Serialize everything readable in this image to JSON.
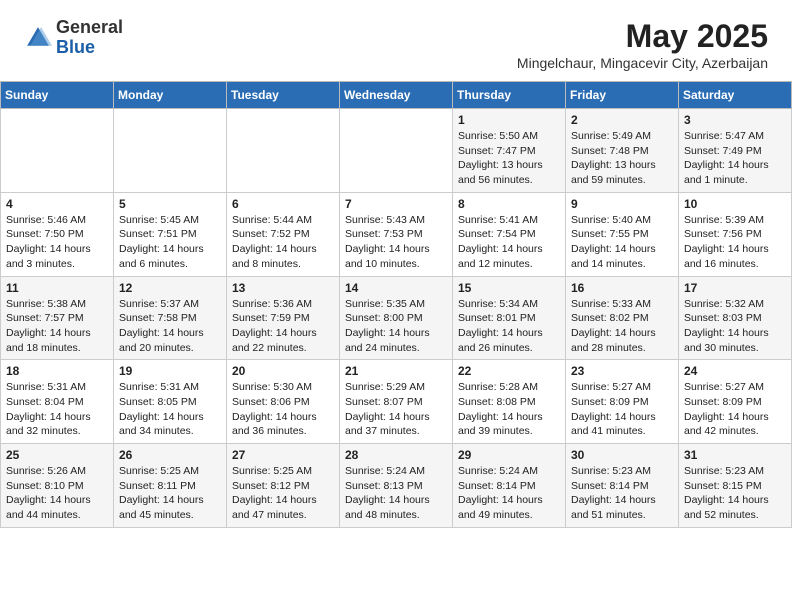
{
  "header": {
    "logo_general": "General",
    "logo_blue": "Blue",
    "month_year": "May 2025",
    "location": "Mingelchaur, Mingacevir City, Azerbaijan"
  },
  "weekdays": [
    "Sunday",
    "Monday",
    "Tuesday",
    "Wednesday",
    "Thursday",
    "Friday",
    "Saturday"
  ],
  "weeks": [
    [
      {
        "day": "",
        "info": ""
      },
      {
        "day": "",
        "info": ""
      },
      {
        "day": "",
        "info": ""
      },
      {
        "day": "",
        "info": ""
      },
      {
        "day": "1",
        "info": "Sunrise: 5:50 AM\nSunset: 7:47 PM\nDaylight: 13 hours\nand 56 minutes."
      },
      {
        "day": "2",
        "info": "Sunrise: 5:49 AM\nSunset: 7:48 PM\nDaylight: 13 hours\nand 59 minutes."
      },
      {
        "day": "3",
        "info": "Sunrise: 5:47 AM\nSunset: 7:49 PM\nDaylight: 14 hours\nand 1 minute."
      }
    ],
    [
      {
        "day": "4",
        "info": "Sunrise: 5:46 AM\nSunset: 7:50 PM\nDaylight: 14 hours\nand 3 minutes."
      },
      {
        "day": "5",
        "info": "Sunrise: 5:45 AM\nSunset: 7:51 PM\nDaylight: 14 hours\nand 6 minutes."
      },
      {
        "day": "6",
        "info": "Sunrise: 5:44 AM\nSunset: 7:52 PM\nDaylight: 14 hours\nand 8 minutes."
      },
      {
        "day": "7",
        "info": "Sunrise: 5:43 AM\nSunset: 7:53 PM\nDaylight: 14 hours\nand 10 minutes."
      },
      {
        "day": "8",
        "info": "Sunrise: 5:41 AM\nSunset: 7:54 PM\nDaylight: 14 hours\nand 12 minutes."
      },
      {
        "day": "9",
        "info": "Sunrise: 5:40 AM\nSunset: 7:55 PM\nDaylight: 14 hours\nand 14 minutes."
      },
      {
        "day": "10",
        "info": "Sunrise: 5:39 AM\nSunset: 7:56 PM\nDaylight: 14 hours\nand 16 minutes."
      }
    ],
    [
      {
        "day": "11",
        "info": "Sunrise: 5:38 AM\nSunset: 7:57 PM\nDaylight: 14 hours\nand 18 minutes."
      },
      {
        "day": "12",
        "info": "Sunrise: 5:37 AM\nSunset: 7:58 PM\nDaylight: 14 hours\nand 20 minutes."
      },
      {
        "day": "13",
        "info": "Sunrise: 5:36 AM\nSunset: 7:59 PM\nDaylight: 14 hours\nand 22 minutes."
      },
      {
        "day": "14",
        "info": "Sunrise: 5:35 AM\nSunset: 8:00 PM\nDaylight: 14 hours\nand 24 minutes."
      },
      {
        "day": "15",
        "info": "Sunrise: 5:34 AM\nSunset: 8:01 PM\nDaylight: 14 hours\nand 26 minutes."
      },
      {
        "day": "16",
        "info": "Sunrise: 5:33 AM\nSunset: 8:02 PM\nDaylight: 14 hours\nand 28 minutes."
      },
      {
        "day": "17",
        "info": "Sunrise: 5:32 AM\nSunset: 8:03 PM\nDaylight: 14 hours\nand 30 minutes."
      }
    ],
    [
      {
        "day": "18",
        "info": "Sunrise: 5:31 AM\nSunset: 8:04 PM\nDaylight: 14 hours\nand 32 minutes."
      },
      {
        "day": "19",
        "info": "Sunrise: 5:31 AM\nSunset: 8:05 PM\nDaylight: 14 hours\nand 34 minutes."
      },
      {
        "day": "20",
        "info": "Sunrise: 5:30 AM\nSunset: 8:06 PM\nDaylight: 14 hours\nand 36 minutes."
      },
      {
        "day": "21",
        "info": "Sunrise: 5:29 AM\nSunset: 8:07 PM\nDaylight: 14 hours\nand 37 minutes."
      },
      {
        "day": "22",
        "info": "Sunrise: 5:28 AM\nSunset: 8:08 PM\nDaylight: 14 hours\nand 39 minutes."
      },
      {
        "day": "23",
        "info": "Sunrise: 5:27 AM\nSunset: 8:09 PM\nDaylight: 14 hours\nand 41 minutes."
      },
      {
        "day": "24",
        "info": "Sunrise: 5:27 AM\nSunset: 8:09 PM\nDaylight: 14 hours\nand 42 minutes."
      }
    ],
    [
      {
        "day": "25",
        "info": "Sunrise: 5:26 AM\nSunset: 8:10 PM\nDaylight: 14 hours\nand 44 minutes."
      },
      {
        "day": "26",
        "info": "Sunrise: 5:25 AM\nSunset: 8:11 PM\nDaylight: 14 hours\nand 45 minutes."
      },
      {
        "day": "27",
        "info": "Sunrise: 5:25 AM\nSunset: 8:12 PM\nDaylight: 14 hours\nand 47 minutes."
      },
      {
        "day": "28",
        "info": "Sunrise: 5:24 AM\nSunset: 8:13 PM\nDaylight: 14 hours\nand 48 minutes."
      },
      {
        "day": "29",
        "info": "Sunrise: 5:24 AM\nSunset: 8:14 PM\nDaylight: 14 hours\nand 49 minutes."
      },
      {
        "day": "30",
        "info": "Sunrise: 5:23 AM\nSunset: 8:14 PM\nDaylight: 14 hours\nand 51 minutes."
      },
      {
        "day": "31",
        "info": "Sunrise: 5:23 AM\nSunset: 8:15 PM\nDaylight: 14 hours\nand 52 minutes."
      }
    ]
  ]
}
